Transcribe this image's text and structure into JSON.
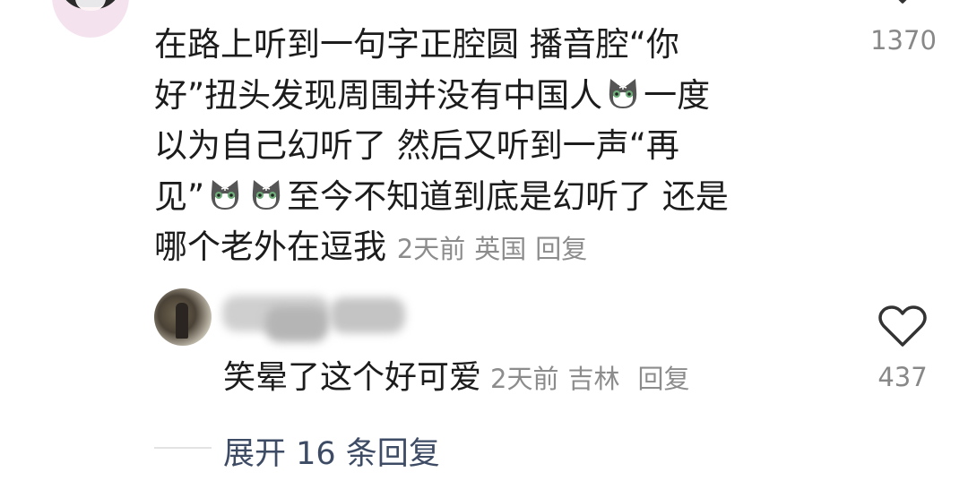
{
  "top_comment": {
    "lines": [
      "在路上听到一句字正腔圆 播音腔“你",
      "好”扭头发现周围并没有中国人",
      "一度",
      "以为自己幻听了 然后又听到一声“再",
      "见”",
      "至今不知道到底是幻听了 还是",
      "哪个老外在逗我"
    ],
    "time": "2天前",
    "location": "英国",
    "reply_label": "回复",
    "like_count": "1370"
  },
  "reply": {
    "text": "笑晕了这个好可爱",
    "time": "2天前",
    "location": "吉林",
    "reply_label": "回复",
    "like_count": "437"
  },
  "expand": {
    "label": "展开 16 条回复"
  },
  "icons": {
    "emoji": "cat-emoji-icon",
    "like": "heart-icon"
  },
  "colors": {
    "text": "#1c1c1c",
    "meta": "#8c8c8c",
    "link": "#3d4b64"
  }
}
